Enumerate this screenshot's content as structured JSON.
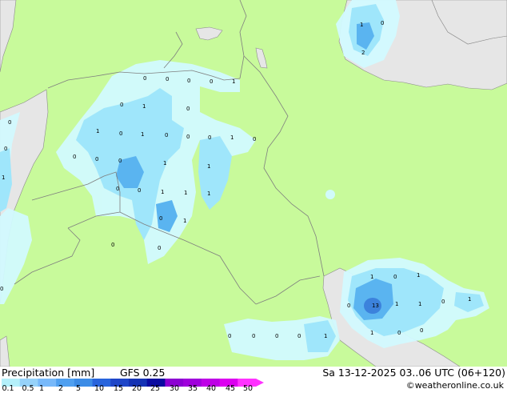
{
  "title": "Precipitation [mm]",
  "model": "GFS 0.25",
  "datetime": "Sa 13-12-2025 03..06 UTC (06+120)",
  "credit": "©weatheronline.co.uk",
  "legend": {
    "ticks": [
      "0.1",
      "0.5",
      "1",
      "2",
      "5",
      "10",
      "15",
      "20",
      "25",
      "30",
      "35",
      "40",
      "45",
      "50"
    ],
    "colors": [
      "#b4f0fa",
      "#96d2fa",
      "#78b9fa",
      "#50a0f0",
      "#3c8ce6",
      "#2864dc",
      "#1e46c8",
      "#1432b4",
      "#0a0aa0",
      "#8c00d2",
      "#a000dc",
      "#be00e6",
      "#dc00f0",
      "#ff32ff"
    ]
  },
  "palette": {
    "land": "#c8fa9b",
    "sea": "#e6e6e6",
    "border": "#7f7f7f",
    "rain_light": "#d2faff",
    "rain_mid": "#9fe6fb",
    "rain_heavy": "#5ab4f0",
    "rain_core": "#3c82dc"
  },
  "precip_labels": [
    {
      "id": "l1",
      "text": "1"
    },
    {
      "id": "l2",
      "text": "0"
    },
    {
      "id": "l3",
      "text": "2"
    },
    {
      "id": "l4",
      "text": "0"
    },
    {
      "id": "l5",
      "text": "0"
    },
    {
      "id": "l6",
      "text": "0"
    },
    {
      "id": "l7",
      "text": "0"
    },
    {
      "id": "l8",
      "text": "1"
    },
    {
      "id": "l9",
      "text": "0"
    },
    {
      "id": "l10",
      "text": "1"
    },
    {
      "id": "l11",
      "text": "0"
    },
    {
      "id": "l12",
      "text": "0"
    },
    {
      "id": "l13",
      "text": "1"
    },
    {
      "id": "l14",
      "text": "0"
    },
    {
      "id": "l15",
      "text": "1"
    },
    {
      "id": "l16",
      "text": "0"
    },
    {
      "id": "l17",
      "text": "0"
    },
    {
      "id": "l18",
      "text": "0"
    },
    {
      "id": "l19",
      "text": "1"
    },
    {
      "id": "l20",
      "text": "0"
    },
    {
      "id": "l21",
      "text": "0"
    },
    {
      "id": "l22",
      "text": "0"
    },
    {
      "id": "l23",
      "text": "0"
    },
    {
      "id": "l24",
      "text": "0"
    },
    {
      "id": "l25",
      "text": "1"
    },
    {
      "id": "l26",
      "text": "1"
    },
    {
      "id": "l27",
      "text": "1"
    },
    {
      "id": "l28",
      "text": "0"
    },
    {
      "id": "l29",
      "text": "0"
    },
    {
      "id": "l30",
      "text": "1"
    },
    {
      "id": "l31",
      "text": "1"
    },
    {
      "id": "l32",
      "text": "1"
    },
    {
      "id": "l33",
      "text": "0"
    },
    {
      "id": "l34",
      "text": "1"
    },
    {
      "id": "l35",
      "text": "0"
    },
    {
      "id": "l36",
      "text": "0"
    },
    {
      "id": "l37",
      "text": "0"
    },
    {
      "id": "l38",
      "text": "1"
    },
    {
      "id": "l39",
      "text": "0"
    },
    {
      "id": "l40",
      "text": "1"
    },
    {
      "id": "l41",
      "text": "13"
    },
    {
      "id": "l42",
      "text": "1"
    },
    {
      "id": "l43",
      "text": "1"
    },
    {
      "id": "l44",
      "text": "0"
    },
    {
      "id": "l45",
      "text": "1"
    },
    {
      "id": "l46",
      "text": "1"
    },
    {
      "id": "l47",
      "text": "0"
    },
    {
      "id": "l48",
      "text": "0"
    },
    {
      "id": "l49",
      "text": "0"
    },
    {
      "id": "l50",
      "text": "0"
    },
    {
      "id": "l51",
      "text": "0"
    },
    {
      "id": "l52",
      "text": "0"
    },
    {
      "id": "l53",
      "text": "0"
    },
    {
      "id": "l54",
      "text": "1"
    }
  ]
}
